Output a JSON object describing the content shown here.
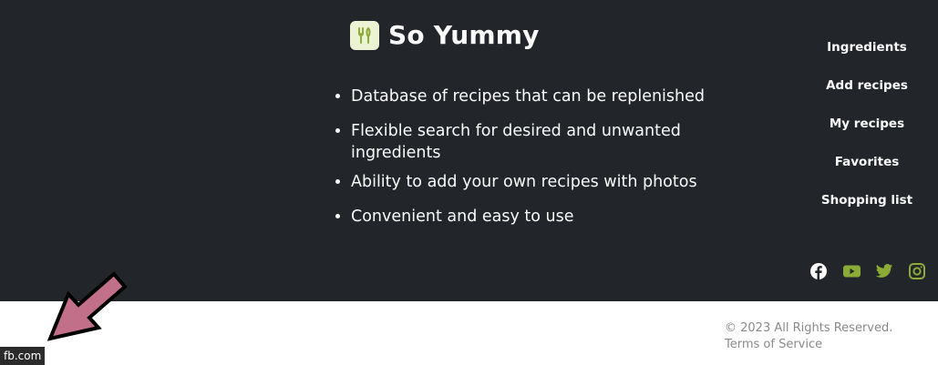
{
  "brand": {
    "name": "So Yummy",
    "icon": "fork-knife-icon"
  },
  "features": [
    "Database of recipes that can be replenished",
    "Flexible search for desired and unwanted ingredients",
    "Ability to add your own recipes with photos",
    "Convenient and easy to use"
  ],
  "nav": [
    "Ingredients",
    "Add recipes",
    "My recipes",
    "Favorites",
    "Shopping list"
  ],
  "social": [
    "facebook-icon",
    "youtube-icon",
    "twitter-icon",
    "instagram-icon"
  ],
  "bottom": {
    "copyright": "© 2023 All Rights Reserved.",
    "terms": "Terms of Service"
  },
  "tooltip": "fb.com",
  "colors": {
    "background": "#22252a",
    "accent": "#8baa36",
    "arrow": "#c2708a"
  }
}
